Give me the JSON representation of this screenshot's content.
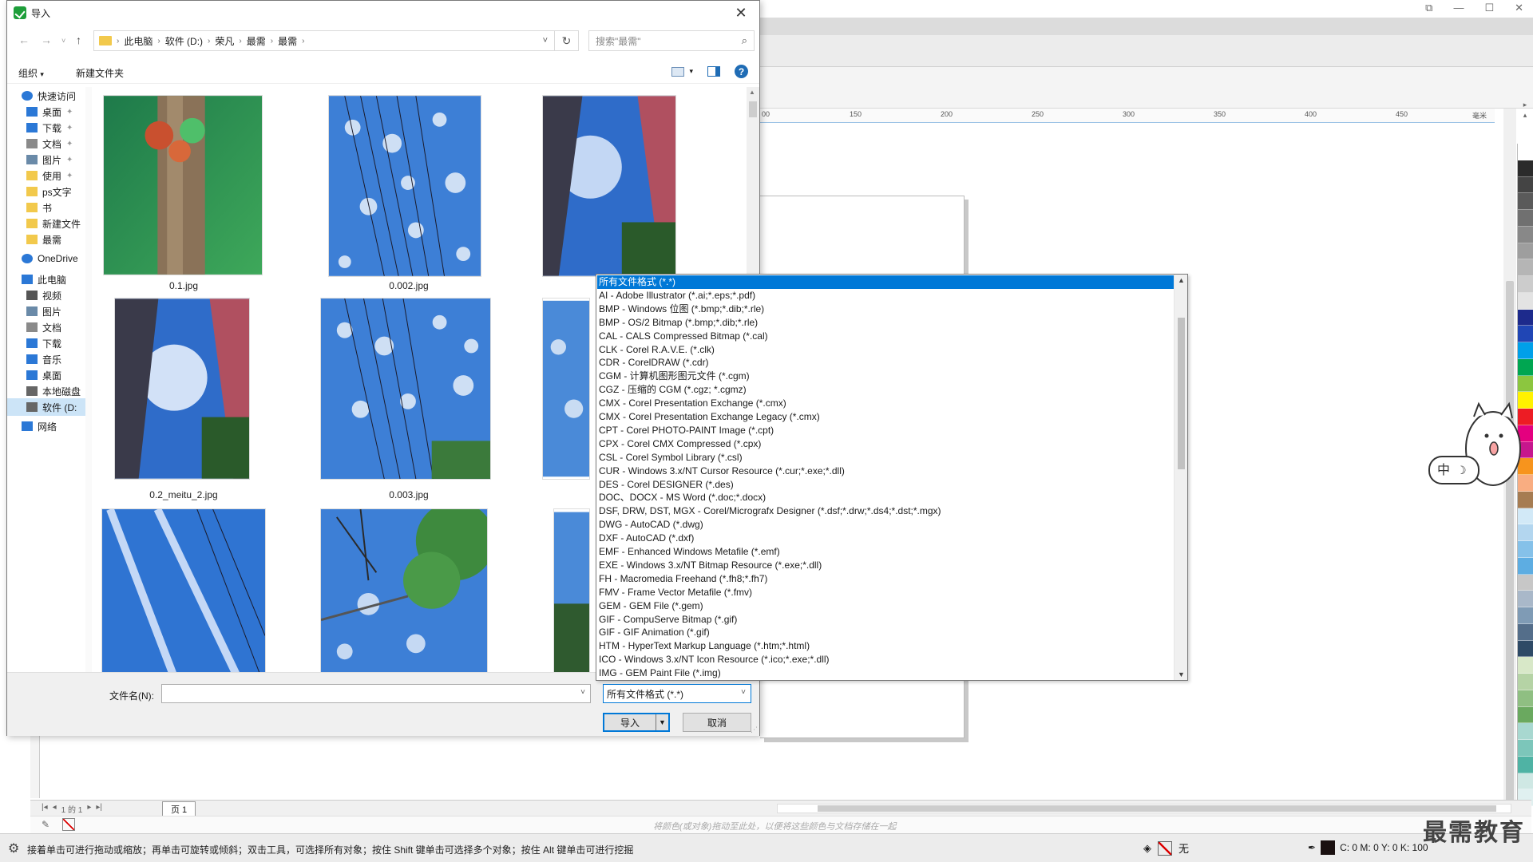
{
  "dialog": {
    "title": "导入",
    "breadcrumb": [
      "此电脑",
      "软件 (D:)",
      "荣凡",
      "最需",
      "最需"
    ],
    "search_placeholder": "搜索\"最需\"",
    "toolbar": {
      "organize": "组织",
      "new_folder": "新建文件夹"
    },
    "nav": [
      {
        "label": "快速访问",
        "icon": "star-icon",
        "pinned": false
      },
      {
        "label": "桌面",
        "icon": "desktop-icon",
        "pinned": true
      },
      {
        "label": "下载",
        "icon": "download-icon",
        "pinned": true
      },
      {
        "label": "文档",
        "icon": "document-icon",
        "pinned": true
      },
      {
        "label": "图片",
        "icon": "picture-icon",
        "pinned": true
      },
      {
        "label": "使用",
        "icon": "folder-icon",
        "pinned": true
      },
      {
        "label": "ps文字",
        "icon": "folder-icon",
        "pinned": false
      },
      {
        "label": "书",
        "icon": "folder-icon",
        "pinned": false
      },
      {
        "label": "新建文件",
        "icon": "folder-icon",
        "pinned": false
      },
      {
        "label": "最需",
        "icon": "folder-icon",
        "pinned": false
      },
      {
        "label": "OneDrive",
        "icon": "cloud-icon",
        "pinned": false
      },
      {
        "label": "此电脑",
        "icon": "computer-icon",
        "pinned": false
      },
      {
        "label": "视频",
        "icon": "video-icon",
        "pinned": false
      },
      {
        "label": "图片",
        "icon": "picture-icon",
        "pinned": false
      },
      {
        "label": "文档",
        "icon": "document-icon",
        "pinned": false
      },
      {
        "label": "下载",
        "icon": "download-icon",
        "pinned": false
      },
      {
        "label": "音乐",
        "icon": "music-icon",
        "pinned": false
      },
      {
        "label": "桌面",
        "icon": "desktop-icon",
        "pinned": false
      },
      {
        "label": "本地磁盘",
        "icon": "drive-icon",
        "pinned": false
      },
      {
        "label": "软件 (D:",
        "icon": "drive-icon",
        "pinned": false
      },
      {
        "label": "网络",
        "icon": "network-icon",
        "pinned": false
      }
    ],
    "files": [
      {
        "name": "0.1.jpg"
      },
      {
        "name": "0.002.jpg"
      },
      {
        "name": ""
      },
      {
        "name": "0.2_meitu_2.jpg"
      },
      {
        "name": "0.003.jpg"
      },
      {
        "name": ""
      },
      {
        "name": ""
      },
      {
        "name": ""
      },
      {
        "name": ""
      }
    ],
    "filename_label": "文件名(N):",
    "filename_value": "",
    "filetype_value": "所有文件格式 (*.*)",
    "import_button": "导入",
    "cancel_button": "取消"
  },
  "filetype_options": [
    "所有文件格式 (*.*)",
    "AI - Adobe Illustrator (*.ai;*.eps;*.pdf)",
    "BMP - Windows 位图 (*.bmp;*.dib;*.rle)",
    "BMP - OS/2 Bitmap (*.bmp;*.dib;*.rle)",
    "CAL - CALS Compressed Bitmap (*.cal)",
    "CLK - Corel R.A.V.E. (*.clk)",
    "CDR - CorelDRAW (*.cdr)",
    "CGM - 计算机图形图元文件 (*.cgm)",
    "CGZ - 压缩的 CGM (*.cgz; *.cgmz)",
    "CMX - Corel Presentation Exchange (*.cmx)",
    "CMX - Corel Presentation Exchange Legacy (*.cmx)",
    "CPT - Corel PHOTO-PAINT Image (*.cpt)",
    "CPX - Corel CMX Compressed (*.cpx)",
    "CSL - Corel Symbol Library (*.csl)",
    "CUR - Windows 3.x/NT Cursor Resource (*.cur;*.exe;*.dll)",
    "DES - Corel DESIGNER (*.des)",
    "DOC、DOCX - MS Word (*.doc;*.docx)",
    "DSF, DRW, DST, MGX - Corel/Micrografx Designer (*.dsf;*.drw;*.ds4;*.dst;*.mgx)",
    "DWG - AutoCAD (*.dwg)",
    "DXF - AutoCAD (*.dxf)",
    "EMF - Enhanced Windows Metafile (*.emf)",
    "EXE - Windows 3.x/NT Bitmap Resource (*.exe;*.dll)",
    "FH - Macromedia Freehand  (*.fh8;*.fh7)",
    "FMV - Frame Vector Metafile (*.fmv)",
    "GEM - GEM File (*.gem)",
    "GIF - CompuServe Bitmap (*.gif)",
    "GIF - GIF Animation (*.gif)",
    "HTM - HyperText Markup Language (*.htm;*.html)",
    "ICO - Windows 3.x/NT Icon Resource (*.ico;*.exe;*.dll)",
    "IMG - GEM Paint File (*.img)"
  ],
  "app": {
    "ruler_ticks": [
      "150",
      "200",
      "250",
      "300",
      "350",
      "400",
      "450"
    ],
    "ruler_unit": "毫米",
    "page_tab": "页 1",
    "page_nav": "1 的 1",
    "hint": "将颜色(或对象)拖动至此处，以便将这些颜色与文档存储在一起",
    "status": "接着单击可进行拖动或缩放；再单击可旋转或倾斜；双击工具，可选择所有对象；按住 Shift 键单击可选择多个对象；按住 Alt 键单击可进行挖掘",
    "fill_status": "无",
    "outline_status": "C: 0 M: 0 Y: 0 K: 100",
    "mascot_text": "中",
    "watermark": "最需教育"
  },
  "palette": [
    "#ffffff",
    "#2b2b2b",
    "#444444",
    "#5a5a5a",
    "#707070",
    "#888888",
    "#9e9e9e",
    "#b5b5b5",
    "#cccccc",
    "#e3e3e3",
    "#1d2a8c",
    "#2046b5",
    "#00a0e9",
    "#00a651",
    "#8cc63f",
    "#fff200",
    "#ed1c24",
    "#e4007f",
    "#c6168d",
    "#f7941d",
    "#f9ad81",
    "#a67c52",
    "#d2e9f7",
    "#b3d6ef",
    "#85c1e9",
    "#5dade2",
    "#c7c7c7",
    "#a9b8c9",
    "#7f9bb5",
    "#546e8a",
    "#2e4a66",
    "#d8e8c8",
    "#b5d3a5",
    "#8fbf82",
    "#6aa95f",
    "#a8d8d0",
    "#7cc6ba",
    "#4fb3a4",
    "#cfe8e4",
    "#e0f0f0"
  ]
}
